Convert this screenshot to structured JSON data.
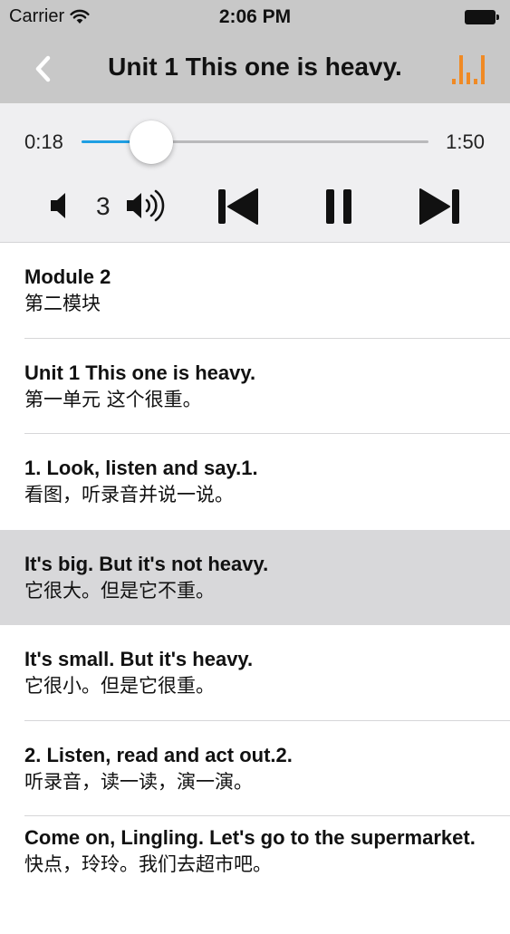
{
  "status_bar": {
    "carrier": "Carrier",
    "time": "2:06 PM"
  },
  "nav": {
    "title": "Unit 1 This one is heavy.",
    "accent_color": "#f08a24"
  },
  "player": {
    "current_time": "0:18",
    "total_time": "1:50",
    "progress": 0.2,
    "volume_level": "3",
    "accent_color": "#1f9fe3"
  },
  "list": {
    "items": [
      {
        "en": "Module 2",
        "zh": "第二模块"
      },
      {
        "en": "Unit 1 This one is heavy.",
        "zh": "第一单元 这个很重。"
      },
      {
        "en": "1. Look, listen and say.1.",
        "zh": "看图，听录音并说一说。"
      },
      {
        "en": "It's big. But it's not heavy.",
        "zh": "它很大。但是它不重。"
      },
      {
        "en": "It's small. But it's heavy.",
        "zh": "它很小。但是它很重。"
      },
      {
        "en": "2. Listen, read and act out.2.",
        "zh": "听录音，读一读，演一演。"
      },
      {
        "en": "Come on, Lingling. Let's go to the supermarket.",
        "zh": "快点，玲玲。我们去超市吧。"
      }
    ]
  }
}
